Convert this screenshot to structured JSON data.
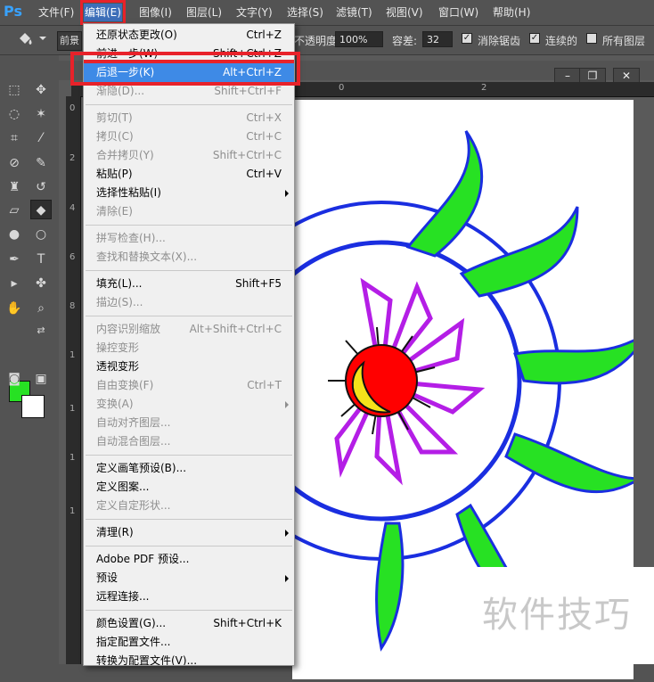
{
  "app_logo": "Ps",
  "menubar": {
    "items": [
      "文件(F)",
      "编辑(E)",
      "图像(I)",
      "图层(L)",
      "文字(Y)",
      "选择(S)",
      "滤镜(T)",
      "视图(V)",
      "窗口(W)",
      "帮助(H)"
    ]
  },
  "optionsbar": {
    "preset_label": "前景",
    "opacity_label": "不透明度:",
    "opacity_value": "100%",
    "tolerance_label": "容差:",
    "tolerance_value": "32",
    "antialias_label": "消除锯齿",
    "contiguous_label": "连续的",
    "all_layers_label": "所有图层"
  },
  "document": {
    "ruler_h": [
      "0",
      "2"
    ],
    "ruler_v": [
      "0",
      "2",
      "4",
      "6",
      "8",
      "1",
      "1",
      "1",
      "1"
    ],
    "window_buttons": [
      "–",
      "❐",
      "✕"
    ]
  },
  "edit_menu": {
    "items": [
      {
        "label": "还原状态更改(O)",
        "shortcut": "Ctrl+Z",
        "disabled": false
      },
      {
        "label": "前进一步(W)",
        "shortcut": "Shift+Ctrl+Z",
        "disabled": false
      },
      {
        "label": "后退一步(K)",
        "shortcut": "Alt+Ctrl+Z",
        "disabled": false,
        "highlight": true
      },
      {
        "label": "渐隐(D)...",
        "shortcut": "Shift+Ctrl+F",
        "disabled": true
      },
      {
        "sep": true
      },
      {
        "label": "剪切(T)",
        "shortcut": "Ctrl+X",
        "disabled": true
      },
      {
        "label": "拷贝(C)",
        "shortcut": "Ctrl+C",
        "disabled": true
      },
      {
        "label": "合并拷贝(Y)",
        "shortcut": "Shift+Ctrl+C",
        "disabled": true
      },
      {
        "label": "粘贴(P)",
        "shortcut": "Ctrl+V",
        "disabled": false
      },
      {
        "label": "选择性粘贴(I)",
        "shortcut": "",
        "disabled": false,
        "submenu": true
      },
      {
        "label": "清除(E)",
        "shortcut": "",
        "disabled": true
      },
      {
        "sep": true
      },
      {
        "label": "拼写检查(H)...",
        "shortcut": "",
        "disabled": true
      },
      {
        "label": "查找和替换文本(X)...",
        "shortcut": "",
        "disabled": true
      },
      {
        "sep": true
      },
      {
        "label": "填充(L)...",
        "shortcut": "Shift+F5",
        "disabled": false
      },
      {
        "label": "描边(S)...",
        "shortcut": "",
        "disabled": true
      },
      {
        "sep": true
      },
      {
        "label": "内容识别缩放",
        "shortcut": "Alt+Shift+Ctrl+C",
        "disabled": true
      },
      {
        "label": "操控变形",
        "shortcut": "",
        "disabled": true
      },
      {
        "label": "透视变形",
        "shortcut": "",
        "disabled": false
      },
      {
        "label": "自由变换(F)",
        "shortcut": "Ctrl+T",
        "disabled": true
      },
      {
        "label": "变换(A)",
        "shortcut": "",
        "disabled": true,
        "submenu": true
      },
      {
        "label": "自动对齐图层...",
        "shortcut": "",
        "disabled": true
      },
      {
        "label": "自动混合图层...",
        "shortcut": "",
        "disabled": true
      },
      {
        "sep": true
      },
      {
        "label": "定义画笔预设(B)...",
        "shortcut": "",
        "disabled": false
      },
      {
        "label": "定义图案...",
        "shortcut": "",
        "disabled": false
      },
      {
        "label": "定义自定形状...",
        "shortcut": "",
        "disabled": true
      },
      {
        "sep": true
      },
      {
        "label": "清理(R)",
        "shortcut": "",
        "disabled": false,
        "submenu": true
      },
      {
        "sep": true
      },
      {
        "label": "Adobe PDF 预设...",
        "shortcut": "",
        "disabled": false
      },
      {
        "label": "预设",
        "shortcut": "",
        "disabled": false,
        "submenu": true
      },
      {
        "label": "远程连接...",
        "shortcut": "",
        "disabled": false
      },
      {
        "sep": true
      },
      {
        "label": "颜色设置(G)...",
        "shortcut": "Shift+Ctrl+K",
        "disabled": false
      },
      {
        "label": "指定配置文件...",
        "shortcut": "",
        "disabled": false
      },
      {
        "label": "转换为配置文件(V)...",
        "shortcut": "",
        "disabled": false
      }
    ]
  },
  "watermark": "软件技巧",
  "colors": {
    "foreground": "#27e123",
    "background": "#ffffff",
    "highlight_border": "#e8222a",
    "menu_highlight": "#3e8ae6"
  }
}
